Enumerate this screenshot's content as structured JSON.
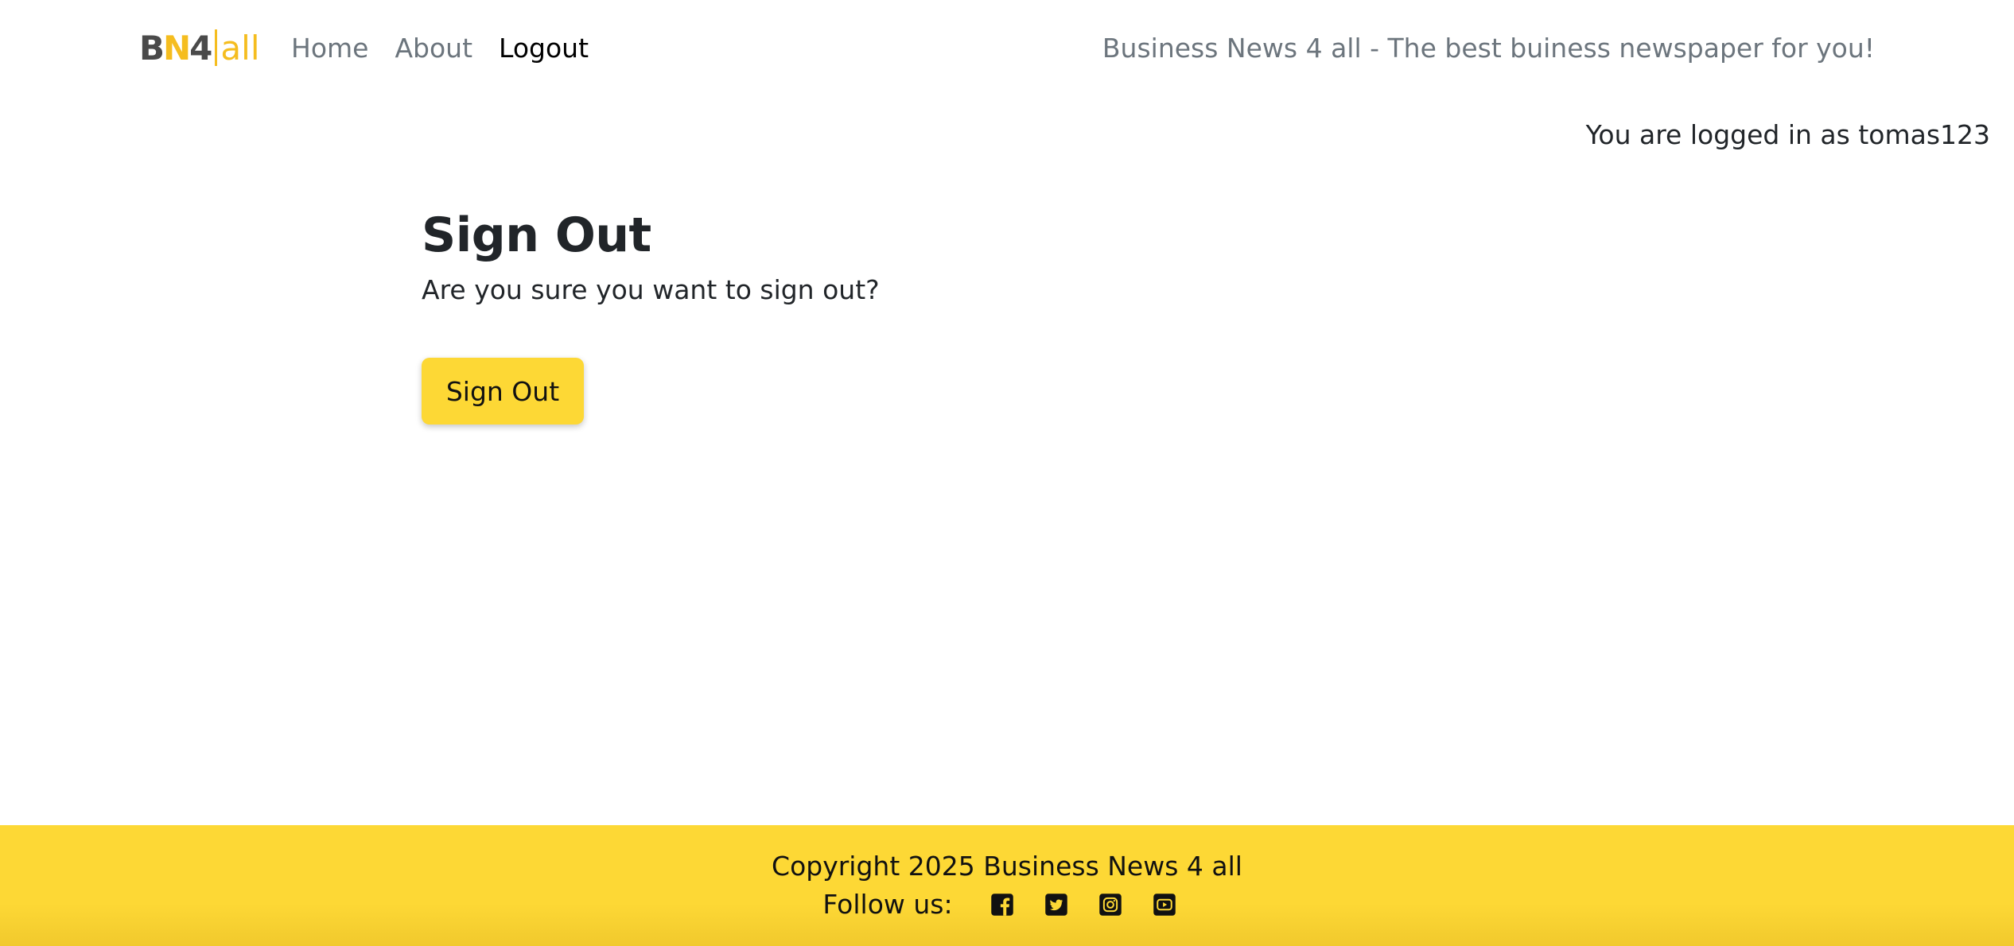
{
  "brand": {
    "b": "B",
    "n": "N",
    "four": "4",
    "all": "all"
  },
  "nav": {
    "items": [
      {
        "label": "Home"
      },
      {
        "label": "About"
      },
      {
        "label": "Logout",
        "active": true
      }
    ]
  },
  "header": {
    "tagline": "Business News 4 all - The best buiness newspaper for you!"
  },
  "user": {
    "logged_in_text": "You are logged in as tomas123"
  },
  "main": {
    "title": "Sign Out",
    "prompt": "Are you sure you want to sign out?",
    "button_label": "Sign Out"
  },
  "footer": {
    "copyright": "Copyright 2025 Business News 4 all",
    "follow_label": "Follow us:",
    "social": [
      {
        "icon": "facebook-icon"
      },
      {
        "icon": "twitter-icon"
      },
      {
        "icon": "instagram-icon"
      },
      {
        "icon": "youtube-icon"
      }
    ]
  },
  "colors": {
    "accent": "#fdd835",
    "brand_yellow": "#f5bd1f",
    "muted_text": "#6c757d"
  }
}
